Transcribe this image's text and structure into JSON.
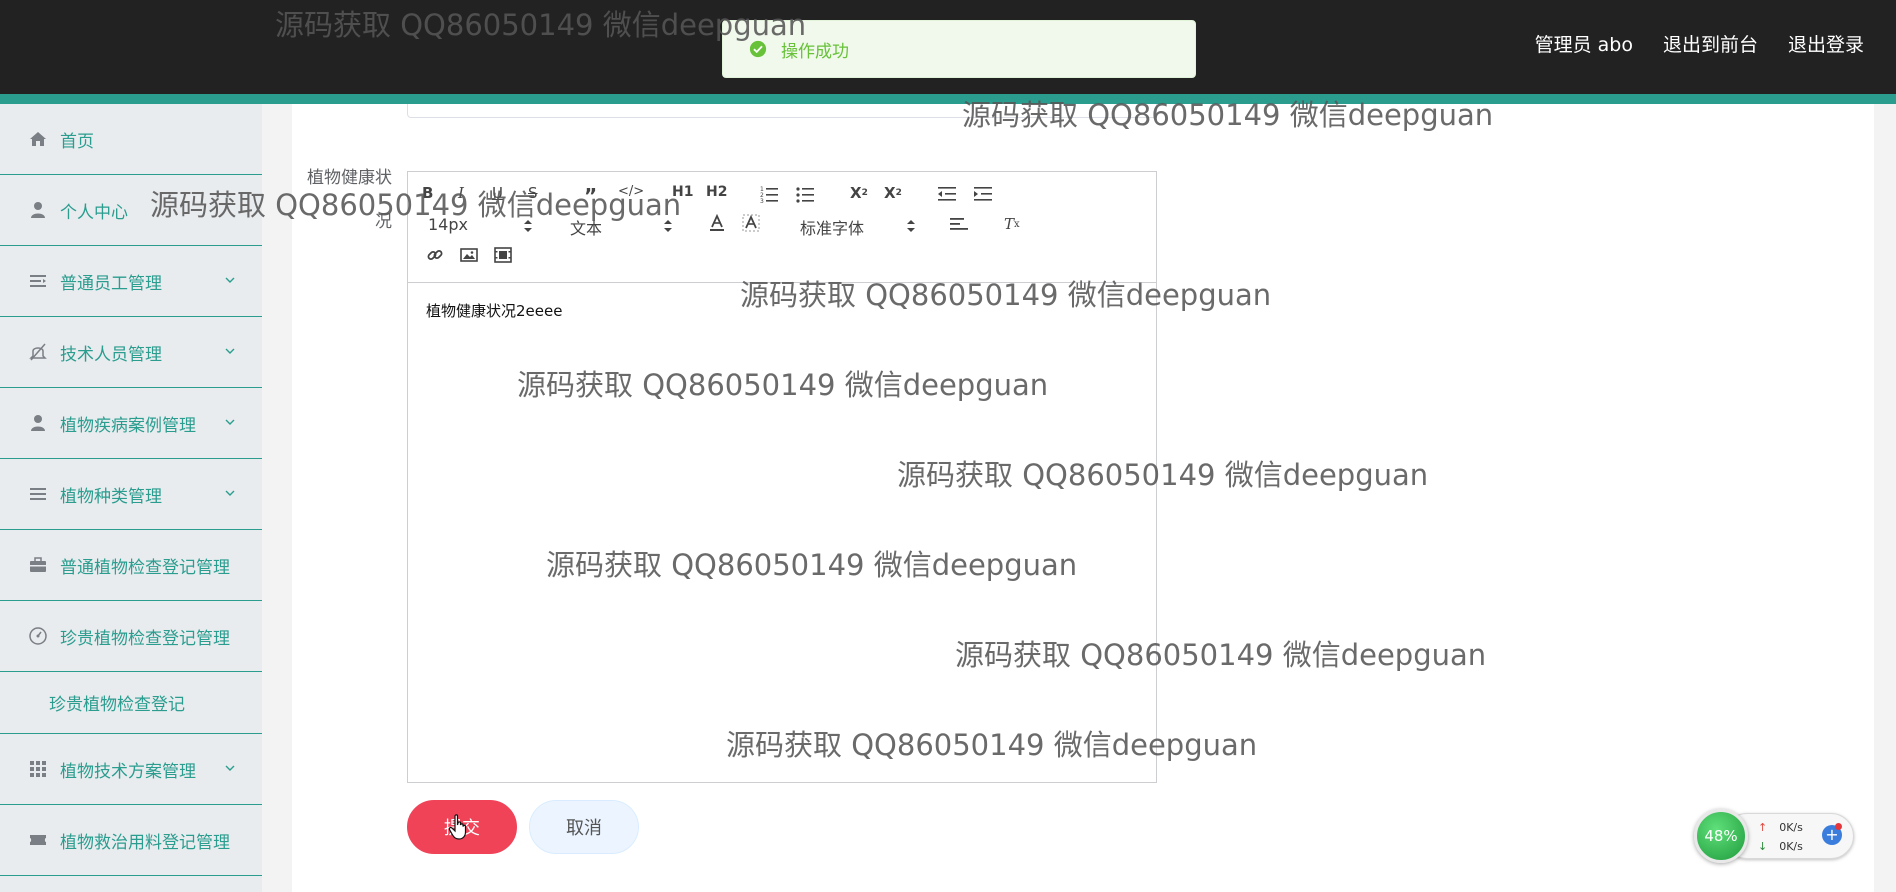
{
  "header": {
    "user_label": "管理员 abo",
    "to_front_label": "退出到前台",
    "logout_label": "退出登录"
  },
  "toast": {
    "message": "操作成功"
  },
  "sidebar": {
    "items": [
      {
        "label": "首页",
        "icon": "home-icon"
      },
      {
        "label": "个人中心",
        "icon": "user-icon"
      },
      {
        "label": "普通员工管理",
        "icon": "list-indent-icon"
      },
      {
        "label": "技术人员管理",
        "icon": "bell-off-icon"
      },
      {
        "label": "植物疾病案例管理",
        "icon": "user-icon"
      },
      {
        "label": "植物种类管理",
        "icon": "list-icon"
      },
      {
        "label": "普通植物检查登记管理",
        "icon": "briefcase-icon"
      },
      {
        "label": "珍贵植物检查登记管理",
        "icon": "gauge-icon"
      },
      {
        "label": "植物技术方案管理",
        "icon": "grid-icon"
      },
      {
        "label": "植物救治用料登记管理",
        "icon": "ticket-icon"
      }
    ],
    "subitem": "珍贵植物检查登记"
  },
  "form": {
    "field_label": "植物健康状况",
    "editor": {
      "font_size": "14px",
      "heading_select": "文本",
      "font_family": "标准字体",
      "content": "植物健康状况2eeee"
    },
    "submit_label": "提交",
    "cancel_label": "取消"
  },
  "watermark": "源码获取 QQ86050149 微信deepguan",
  "net_widget": {
    "percent": "48%",
    "up_speed": "0K/s",
    "down_speed": "0K/s"
  },
  "colors": {
    "accent": "#2a9d8f",
    "header_bg": "#222222",
    "submit": "#f04358",
    "toast_text": "#67c23a"
  }
}
